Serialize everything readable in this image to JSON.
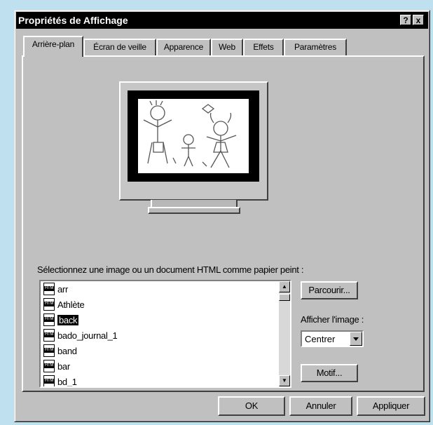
{
  "window": {
    "title": "Propriétés de Affichage",
    "help_button": "?",
    "close_button": "x"
  },
  "tabs": [
    {
      "label": "Arrière-plan",
      "active": true
    },
    {
      "label": "Écran de veille",
      "active": false
    },
    {
      "label": "Apparence",
      "active": false
    },
    {
      "label": "Web",
      "active": false
    },
    {
      "label": "Effets",
      "active": false
    },
    {
      "label": "Paramètres",
      "active": false
    }
  ],
  "wallpaper": {
    "select_label": "Sélectionnez une image ou un document HTML comme papier peint :",
    "items": [
      {
        "label": "arr",
        "selected": false
      },
      {
        "label": "Athlète",
        "selected": false
      },
      {
        "label": "back",
        "selected": true
      },
      {
        "label": "bado_journal_1",
        "selected": false
      },
      {
        "label": "band",
        "selected": false
      },
      {
        "label": "bar",
        "selected": false
      },
      {
        "label": "bd_1",
        "selected": false
      }
    ]
  },
  "buttons": {
    "browse": "Parcourir...",
    "pattern": "Motif...",
    "ok": "OK",
    "cancel": "Annuler",
    "apply": "Appliquer"
  },
  "display": {
    "label": "Afficher l'image :",
    "value": "Centrer"
  }
}
